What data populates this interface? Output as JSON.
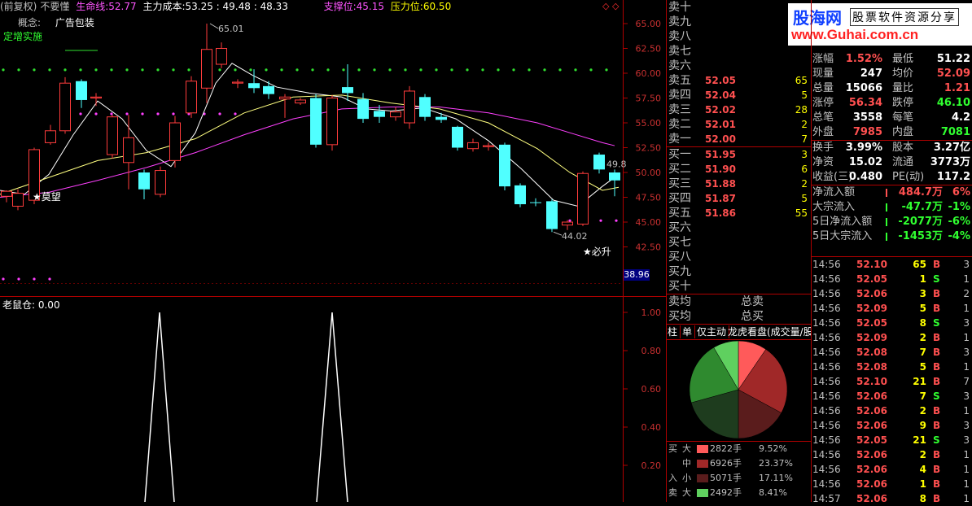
{
  "header": {
    "adjust": "(前复权)",
    "title": "不要懂",
    "life_line_label": "生命线:",
    "life_line_value": "52.77",
    "main_cost_label": "主力成本:",
    "main_cost_values": "53.25 : 49.48 : 48.33",
    "support_label": "支撑位:",
    "support_value": "45.15",
    "pressure_label": "压力位:",
    "pressure_value": "60.50",
    "concept_label": "概念:",
    "concept_value": "广告包装",
    "tag": "定增实施"
  },
  "watermark": {
    "brand": "股海网",
    "subtitle": "股票软件资源分享",
    "url": "www.Guhai.com.cn"
  },
  "candle_chart": {
    "price_axis": [
      "65.00",
      "62.50",
      "60.00",
      "57.50",
      "55.00",
      "52.50",
      "50.00",
      "47.50",
      "45.00",
      "42.50"
    ],
    "current_price_tag": "38.96",
    "high_label": "65.01",
    "low_label": "44.02",
    "right_label": "49.8",
    "star_left": "★莫望",
    "star_right": "★必升"
  },
  "sub_chart": {
    "title": "老鼠仓: 0.00",
    "axis": [
      "1.00",
      "0.80",
      "0.60",
      "0.40",
      "0.20"
    ]
  },
  "order_book": {
    "sell": [
      {
        "label": "卖十",
        "price": "",
        "vol": ""
      },
      {
        "label": "卖九",
        "price": "",
        "vol": ""
      },
      {
        "label": "卖八",
        "price": "",
        "vol": ""
      },
      {
        "label": "卖七",
        "price": "",
        "vol": ""
      },
      {
        "label": "卖六",
        "price": "",
        "vol": ""
      },
      {
        "label": "卖五",
        "price": "52.05",
        "vol": "65"
      },
      {
        "label": "卖四",
        "price": "52.04",
        "vol": "5"
      },
      {
        "label": "卖三",
        "price": "52.02",
        "vol": "28"
      },
      {
        "label": "卖二",
        "price": "52.01",
        "vol": "2"
      },
      {
        "label": "卖一",
        "price": "52.00",
        "vol": "7"
      }
    ],
    "buy": [
      {
        "label": "买一",
        "price": "51.95",
        "vol": "3"
      },
      {
        "label": "买二",
        "price": "51.90",
        "vol": "6"
      },
      {
        "label": "买三",
        "price": "51.88",
        "vol": "2"
      },
      {
        "label": "买四",
        "price": "51.87",
        "vol": "5"
      },
      {
        "label": "买五",
        "price": "51.86",
        "vol": "55"
      },
      {
        "label": "买六",
        "price": "",
        "vol": ""
      },
      {
        "label": "买七",
        "price": "",
        "vol": ""
      },
      {
        "label": "买八",
        "price": "",
        "vol": ""
      },
      {
        "label": "买九",
        "price": "",
        "vol": ""
      },
      {
        "label": "买十",
        "price": "",
        "vol": ""
      }
    ],
    "avg_sell_label": "卖均",
    "avg_buy_label": "买均",
    "total_sell_label": "总卖",
    "total_buy_label": "总买"
  },
  "pie_panel": {
    "tabs": [
      "柱",
      "单",
      "仅主动",
      "龙虎看盘(成交量/股"
    ],
    "side_labels": [
      "买",
      "入",
      "卖"
    ],
    "rows": [
      {
        "size": "大",
        "vol": "2822手",
        "pct": "9.52%",
        "color": "#ff5a5a"
      },
      {
        "size": "中",
        "vol": "6926手",
        "pct": "23.37%",
        "color": "#a02828"
      },
      {
        "size": "小",
        "vol": "5071手",
        "pct": "17.11%",
        "color": "#5a1c1c"
      },
      {
        "size": "大",
        "vol": "2492手",
        "pct": "8.41%",
        "color": "#5fd05f"
      }
    ],
    "slices": [
      9.52,
      23.37,
      17.11,
      20.7,
      20.89,
      8.41
    ],
    "slice_colors": [
      "#ff5a5a",
      "#a02828",
      "#5a1c1c",
      "#1e3c1e",
      "#2f8a2f",
      "#5fd05f"
    ]
  },
  "quote": {
    "rows": [
      {
        "l1": "涨幅",
        "v1": "1.52%",
        "c1": "#ff5050",
        "l2": "最低",
        "v2": "51.22",
        "c2": "#ffffff"
      },
      {
        "l1": "现量",
        "v1": "247",
        "c1": "#ffffff",
        "l2": "均价",
        "v2": "52.09",
        "c2": "#ff5050"
      },
      {
        "l1": "总量",
        "v1": "15066",
        "c1": "#ffffff",
        "l2": "量比",
        "v2": "1.21",
        "c2": "#ff5050"
      },
      {
        "l1": "涨停",
        "v1": "56.34",
        "c1": "#ff5050",
        "l2": "跌停",
        "v2": "46.10",
        "c2": "#30ff30"
      },
      {
        "l1": "总笔",
        "v1": "3558",
        "c1": "#ffffff",
        "l2": "每笔",
        "v2": "4.2",
        "c2": "#ffffff"
      },
      {
        "l1": "外盘",
        "v1": "7985",
        "c1": "#ff5050",
        "l2": "内盘",
        "v2": "7081",
        "c2": "#30ff30"
      },
      {
        "l1": "换手",
        "v1": "3.99%",
        "c1": "#ffffff",
        "l2": "股本",
        "v2": "3.27亿",
        "c2": "#ffffff"
      },
      {
        "l1": "净资",
        "v1": "15.02",
        "c1": "#ffffff",
        "l2": "流通",
        "v2": "3773万",
        "c2": "#ffffff"
      },
      {
        "l1": "收益(三)",
        "v1": "0.480",
        "c1": "#ffffff",
        "l2": "PE(动)",
        "v2": "117.2",
        "c2": "#ffffff"
      }
    ],
    "flows": [
      {
        "label": "净流入额",
        "value": "484.7万",
        "pct": "6%",
        "color": "#ff5050"
      },
      {
        "label": "大宗流入",
        "value": "-47.7万",
        "pct": "-1%",
        "color": "#30ff30"
      },
      {
        "label": "5日净流入额",
        "value": "-2077万",
        "pct": "-6%",
        "color": "#30ff30"
      },
      {
        "label": "5日大宗流入",
        "value": "-1453万",
        "pct": "-4%",
        "color": "#30ff30"
      }
    ]
  },
  "ticks": [
    {
      "t": "14:56",
      "p": "52.10",
      "v": "65",
      "s": "B",
      "n": "3"
    },
    {
      "t": "14:56",
      "p": "52.05",
      "v": "1",
      "s": "S",
      "n": "1"
    },
    {
      "t": "14:56",
      "p": "52.06",
      "v": "3",
      "s": "B",
      "n": "2"
    },
    {
      "t": "14:56",
      "p": "52.09",
      "v": "5",
      "s": "B",
      "n": "1"
    },
    {
      "t": "14:56",
      "p": "52.05",
      "v": "8",
      "s": "S",
      "n": "3"
    },
    {
      "t": "14:56",
      "p": "52.09",
      "v": "2",
      "s": "B",
      "n": "1"
    },
    {
      "t": "14:56",
      "p": "52.08",
      "v": "7",
      "s": "B",
      "n": "3"
    },
    {
      "t": "14:56",
      "p": "52.08",
      "v": "5",
      "s": "B",
      "n": "1"
    },
    {
      "t": "14:56",
      "p": "52.10",
      "v": "21",
      "s": "B",
      "n": "7"
    },
    {
      "t": "14:56",
      "p": "52.06",
      "v": "7",
      "s": "S",
      "n": "3"
    },
    {
      "t": "14:56",
      "p": "52.06",
      "v": "2",
      "s": "B",
      "n": "1"
    },
    {
      "t": "14:56",
      "p": "52.06",
      "v": "9",
      "s": "B",
      "n": "3"
    },
    {
      "t": "14:56",
      "p": "52.05",
      "v": "21",
      "s": "S",
      "n": "3"
    },
    {
      "t": "14:56",
      "p": "52.06",
      "v": "2",
      "s": "B",
      "n": "1"
    },
    {
      "t": "14:56",
      "p": "52.06",
      "v": "4",
      "s": "B",
      "n": "1"
    },
    {
      "t": "14:56",
      "p": "52.06",
      "v": "1",
      "s": "B",
      "n": "1"
    },
    {
      "t": "14:57",
      "p": "52.06",
      "v": "8",
      "s": "B",
      "n": "1"
    }
  ]
}
